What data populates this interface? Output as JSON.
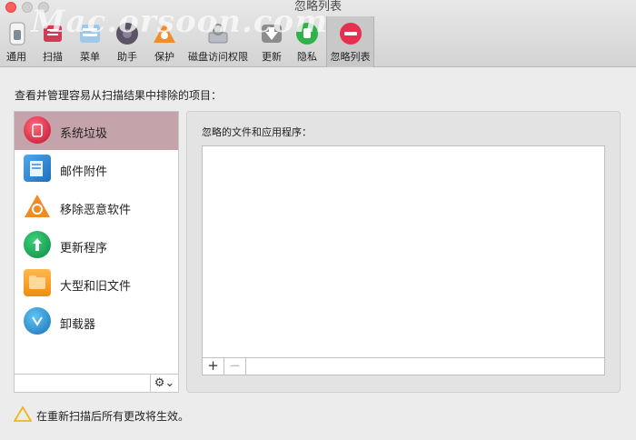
{
  "window": {
    "title": "忽略列表"
  },
  "watermark": "Mac.orsoon.com",
  "toolbar": {
    "items": [
      {
        "label": "通用",
        "icon": "switch-icon"
      },
      {
        "label": "扫描",
        "icon": "scan-icon"
      },
      {
        "label": "菜单",
        "icon": "menu-icon"
      },
      {
        "label": "助手",
        "icon": "assistant-icon"
      },
      {
        "label": "保护",
        "icon": "protection-icon"
      },
      {
        "label": "磁盘访问权限",
        "icon": "disk-access-icon"
      },
      {
        "label": "更新",
        "icon": "update-download-icon"
      },
      {
        "label": "隐私",
        "icon": "privacy-hand-icon"
      },
      {
        "label": "忽略列表",
        "icon": "ignore-minus-icon",
        "active": true
      }
    ]
  },
  "instruction": "查看并管理容易从扫描结果中排除的项目：",
  "modules": [
    {
      "label": "系统垃圾",
      "icon": "system-junk-icon",
      "selected": true
    },
    {
      "label": "邮件附件",
      "icon": "mail-attachments-icon"
    },
    {
      "label": "移除恶意软件",
      "icon": "malware-biohazard-icon"
    },
    {
      "label": "更新程序",
      "icon": "updater-arrow-icon"
    },
    {
      "label": "大型和旧文件",
      "icon": "large-old-files-icon"
    },
    {
      "label": "卸载器",
      "icon": "uninstaller-icon"
    }
  ],
  "ignored_panel": {
    "label": "忽略的文件和应用程序：",
    "add": "+",
    "remove": "−"
  },
  "gear_menu": "⚙⌄",
  "footer": {
    "warning": "在重新扫描后所有更改将生效。"
  },
  "colors": {
    "selected_row": "#c4a3ab",
    "close_button": "#fc605b"
  }
}
